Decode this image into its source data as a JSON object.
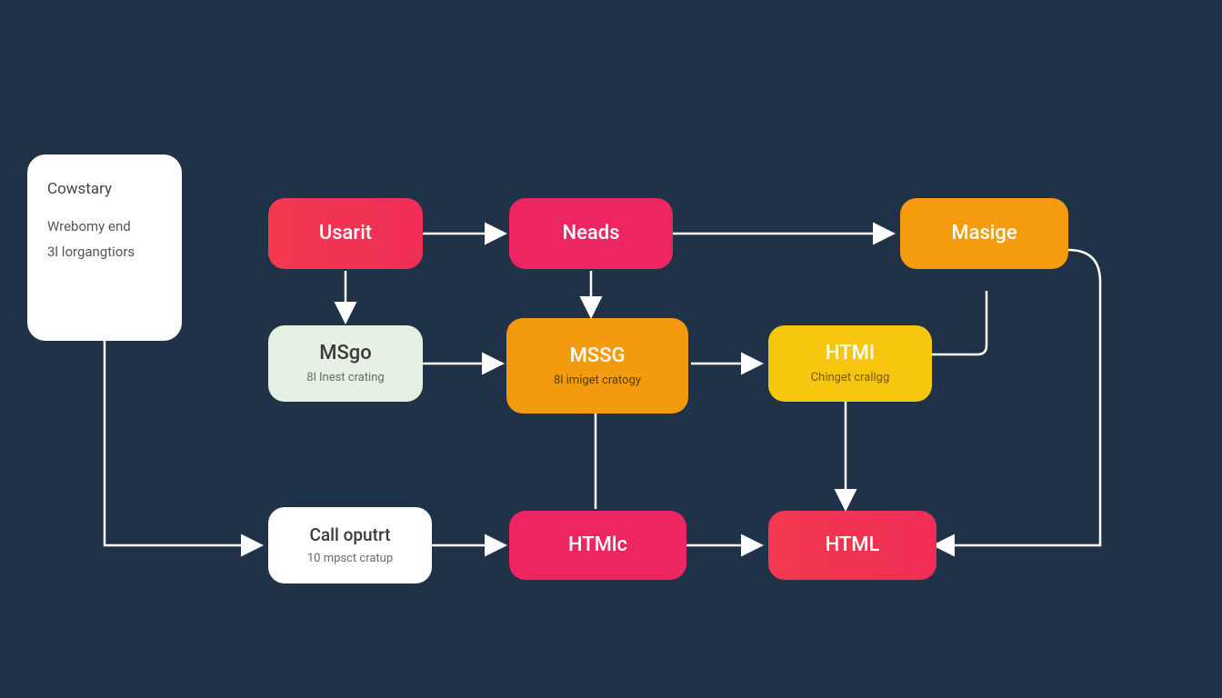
{
  "sidecard": {
    "title": "Cowstary",
    "line1": "Wrebomy end",
    "line2": "3l lorgangtiors"
  },
  "nodes": {
    "usarit": {
      "title": "Usarit"
    },
    "neads": {
      "title": "Neads"
    },
    "masige": {
      "title": "Masige"
    },
    "msgo": {
      "title": "MSgo",
      "subtitle": "8l Inest crating"
    },
    "mssg": {
      "title": "MSSG",
      "subtitle": "8l imiget cratogy"
    },
    "htmi": {
      "title": "HTMI",
      "subtitle": "Chinget crallgg"
    },
    "calloput": {
      "title": "Call oputrt",
      "subtitle": "10 mpsct cratup"
    },
    "htmic": {
      "title": "HTMlc"
    },
    "html": {
      "title": "HTML"
    }
  },
  "colors": {
    "bg": "#1f3248",
    "white": "#ffffff",
    "red": "#f4394e",
    "pink": "#ed2662",
    "orange": "#f59b0d",
    "orange2": "#f39a0e",
    "yellow": "#f7c60f",
    "lightgreen": "#e6f0e3",
    "arrow": "#ffffff"
  }
}
